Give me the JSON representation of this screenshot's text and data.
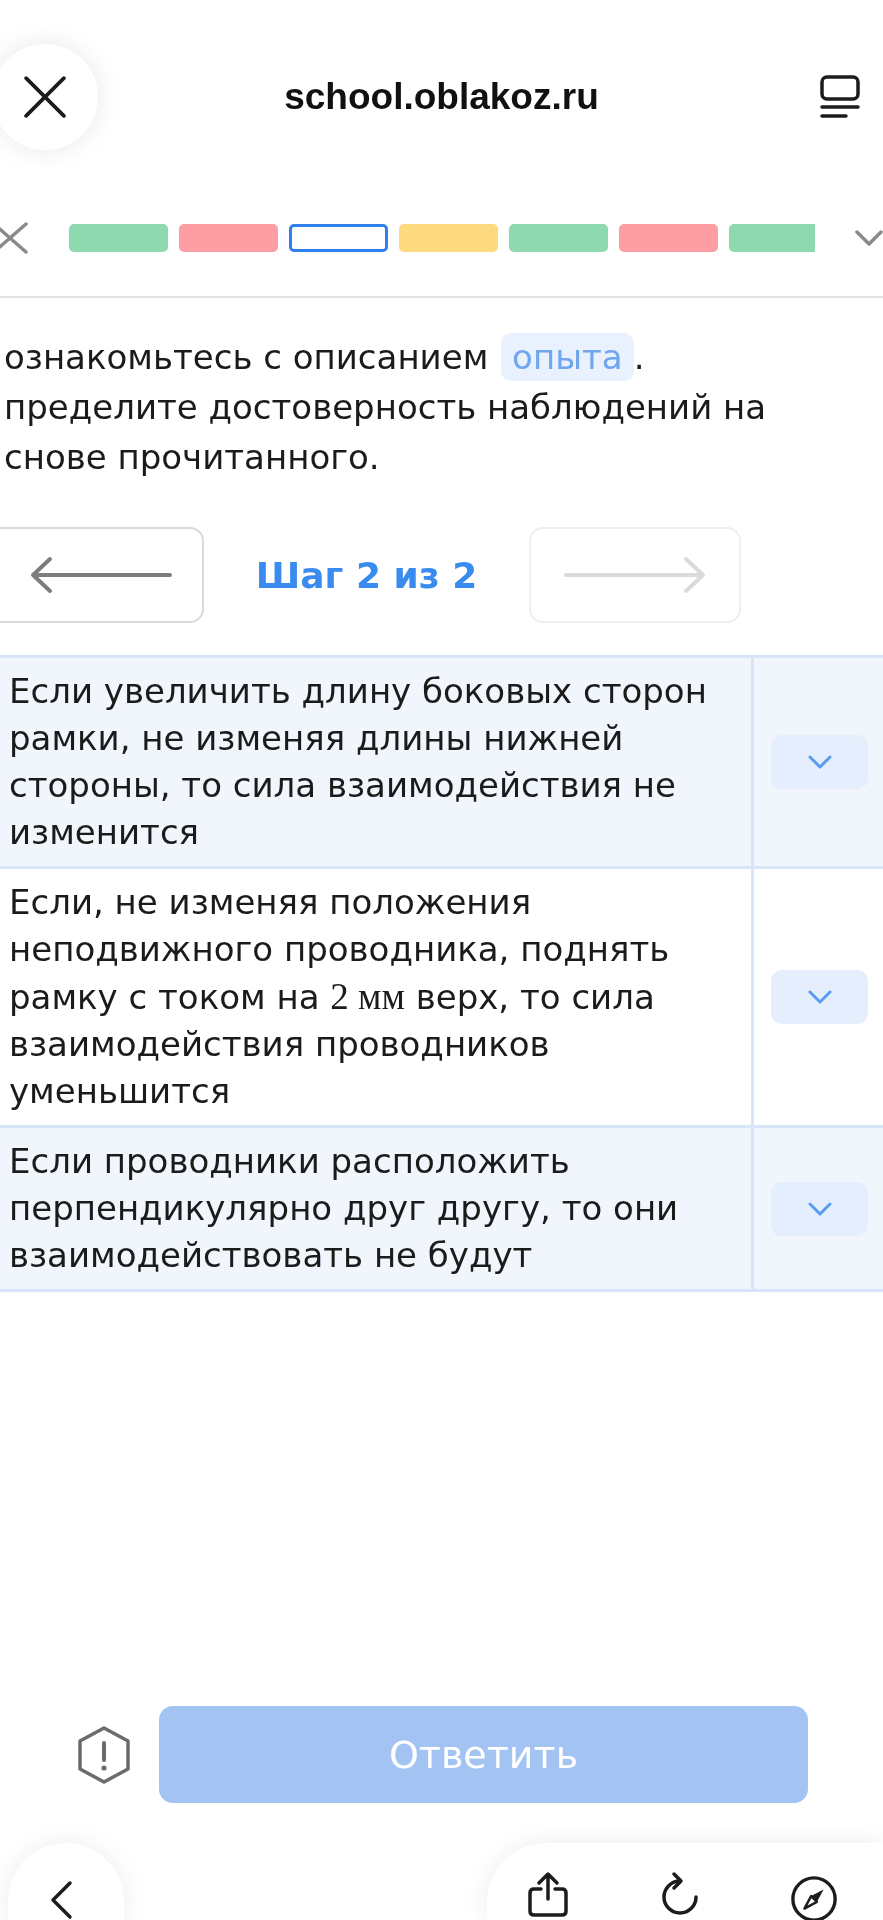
{
  "browser": {
    "address": "school.oblakoz.ru"
  },
  "progress": {
    "items": [
      {
        "color": "#8fd9b0",
        "selected": false
      },
      {
        "color": "#fc9ea4",
        "selected": false
      },
      {
        "color": "#ffffff",
        "selected": true
      },
      {
        "color": "#fdd97f",
        "selected": false
      },
      {
        "color": "#8fd9b0",
        "selected": false
      },
      {
        "color": "#fc9ea4",
        "selected": false
      },
      {
        "color": "#8fd9b0",
        "selected": false
      }
    ]
  },
  "task": {
    "intro_before": "ознакомьтесь с описанием",
    "link": "опыта",
    "intro_after": ". пределите достоверность наблюдений на снове прочитанного."
  },
  "step_nav": {
    "prev": {
      "disabled": false
    },
    "label": "Шаг 2 из 2",
    "next": {
      "disabled": true
    }
  },
  "statements": [
    {
      "parts": [
        {
          "kind": "text",
          "text": "Если увеличить длину боковых сторон рамки, не изменяя длины нижней стороны, то сила взаимодействия не изменится"
        }
      ]
    },
    {
      "parts": [
        {
          "kind": "text",
          "text": "Если, не изменяя положения неподвижного проводника, поднять рамку с током на "
        },
        {
          "kind": "math",
          "text": "2 мм"
        },
        {
          "kind": "text",
          "text": " верх, то сила взаимодействия проводников уменьшится"
        }
      ]
    },
    {
      "parts": [
        {
          "kind": "text",
          "text": "Если проводники расположить перпендикулярно друг другу, то они взаимодействовать не будут"
        }
      ]
    }
  ],
  "answer_button": {
    "label": "Ответить",
    "disabled": true
  }
}
